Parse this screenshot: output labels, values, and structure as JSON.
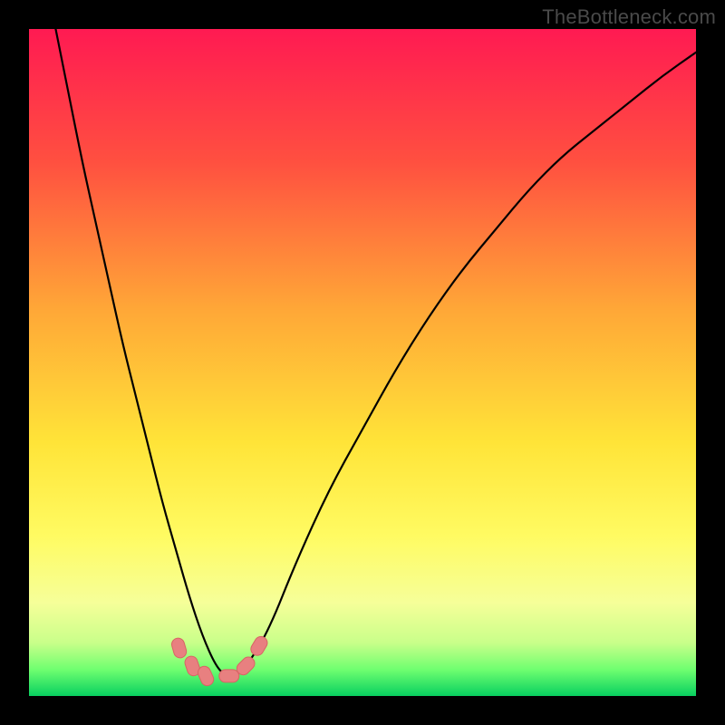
{
  "watermark": "TheBottleneck.com",
  "chart_data": {
    "type": "line",
    "title": "",
    "xlabel": "",
    "ylabel": "",
    "xlim": [
      0,
      1
    ],
    "ylim": [
      0,
      1
    ],
    "gradient_bg": {
      "stops": [
        {
          "offset": 0.0,
          "color": "#ff1a52"
        },
        {
          "offset": 0.2,
          "color": "#ff5040"
        },
        {
          "offset": 0.42,
          "color": "#ffa737"
        },
        {
          "offset": 0.62,
          "color": "#ffe438"
        },
        {
          "offset": 0.76,
          "color": "#fffb62"
        },
        {
          "offset": 0.86,
          "color": "#f6ff99"
        },
        {
          "offset": 0.92,
          "color": "#c9ff8a"
        },
        {
          "offset": 0.96,
          "color": "#70ff70"
        },
        {
          "offset": 1.0,
          "color": "#08d060"
        }
      ]
    },
    "series": [
      {
        "name": "curve",
        "x": [
          0.04,
          0.06,
          0.08,
          0.1,
          0.12,
          0.14,
          0.16,
          0.18,
          0.2,
          0.22,
          0.24,
          0.26,
          0.28,
          0.295,
          0.31,
          0.33,
          0.36,
          0.4,
          0.45,
          0.5,
          0.55,
          0.6,
          0.65,
          0.7,
          0.75,
          0.8,
          0.85,
          0.9,
          0.95,
          1.0
        ],
        "y": [
          1.0,
          0.9,
          0.8,
          0.71,
          0.62,
          0.53,
          0.45,
          0.37,
          0.29,
          0.22,
          0.15,
          0.09,
          0.045,
          0.03,
          0.03,
          0.05,
          0.1,
          0.2,
          0.31,
          0.4,
          0.49,
          0.57,
          0.64,
          0.7,
          0.76,
          0.81,
          0.85,
          0.89,
          0.93,
          0.965
        ]
      }
    ],
    "markers": [
      {
        "x": 0.225,
        "y": 0.072
      },
      {
        "x": 0.245,
        "y": 0.045
      },
      {
        "x": 0.265,
        "y": 0.03
      },
      {
        "x": 0.3,
        "y": 0.03
      },
      {
        "x": 0.325,
        "y": 0.045
      },
      {
        "x": 0.345,
        "y": 0.075
      }
    ],
    "marker_style": {
      "color": "#e88080",
      "rx": 7,
      "ry": 11,
      "stroke": "#d86464"
    }
  }
}
